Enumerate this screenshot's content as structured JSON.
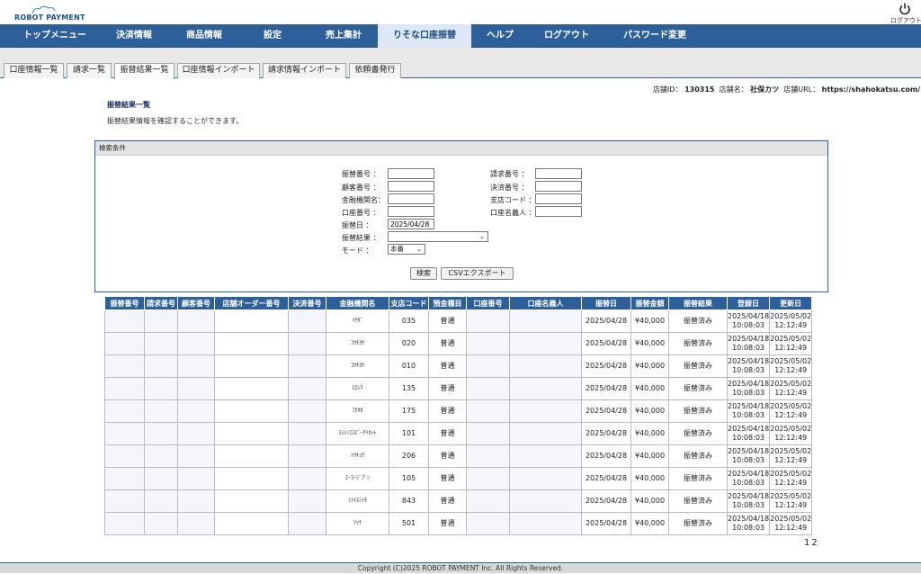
{
  "brand": {
    "logo_text": "ROBOT PAYMENT"
  },
  "header": {
    "logout_label": "ログアウト"
  },
  "nav": {
    "items": [
      {
        "label": "トップメニュー"
      },
      {
        "label": "決済情報"
      },
      {
        "label": "商品情報"
      },
      {
        "label": "設定"
      },
      {
        "label": "売上集計"
      },
      {
        "label": "りそな口座振替"
      },
      {
        "label": "ヘルプ"
      },
      {
        "label": "ログアウト"
      },
      {
        "label": "パスワード変更"
      }
    ],
    "active": "りそな口座振替"
  },
  "subtabs": [
    {
      "label": "口座情報一覧"
    },
    {
      "label": "請求一覧"
    },
    {
      "label": "振替結果一覧"
    },
    {
      "label": "口座情報インポート"
    },
    {
      "label": "請求情報インポート"
    },
    {
      "label": "依頼書発行"
    }
  ],
  "store": {
    "id_label": "店舗ID：",
    "id_value": "130315",
    "name_label": "店舗名：",
    "name_value": "社保カツ",
    "url_label": "店舗URL：",
    "url_value": "https://shahokatsu.com/"
  },
  "page": {
    "title": "振替結果一覧",
    "description": "振替結果情報を確認することができます。"
  },
  "search": {
    "header": "検索条件",
    "fields": {
      "transfer_no": {
        "label": "振替番号 ：",
        "value": ""
      },
      "customer_no": {
        "label": "顧客番号 ：",
        "value": ""
      },
      "bank_name": {
        "label": "金融機関名：",
        "value": ""
      },
      "account_no": {
        "label": "口座番号 ：",
        "value": ""
      },
      "transfer_date": {
        "label": "振替日 ：",
        "value": "2025/04/28"
      },
      "transfer_result": {
        "label": "振替結果 ：",
        "value": ""
      },
      "mode": {
        "label": "モード ：",
        "value": "本番"
      },
      "billing_no": {
        "label": "請求番号 ：",
        "value": ""
      },
      "payment_no": {
        "label": "決済番号 ：",
        "value": ""
      },
      "branch_code": {
        "label": "支店コード ：",
        "value": ""
      },
      "account_holder": {
        "label": "口座名義人 ：",
        "value": ""
      }
    },
    "search_button": "検索",
    "csv_button": "CSVエクスポート"
  },
  "table": {
    "columns": [
      "振替番号",
      "請求番号",
      "顧客番号",
      "店舗オーダー番号",
      "決済番号",
      "金融機関名",
      "支店コード",
      "預金種目",
      "口座番号",
      "口座名義人",
      "振替日",
      "振替金額",
      "振替結果",
      "登録日",
      "更新日"
    ],
    "rows": [
      {
        "bank": "ｲｹﾀﾞ",
        "branch": "035",
        "type": "普通",
        "date": "2025/04/28",
        "amount": "¥40,000",
        "result": "振替済み",
        "reg_d": "2025/04/18",
        "reg_t": "10:08:03",
        "upd_d": "2025/05/02",
        "upd_t": "12:12:49"
      },
      {
        "bank": "ｺｳﾁﾖｳ",
        "branch": "020",
        "type": "普通",
        "date": "2025/04/28",
        "amount": "¥40,000",
        "result": "振替済み",
        "reg_d": "2025/04/18",
        "reg_t": "10:08:03",
        "upd_d": "2025/05/02",
        "upd_t": "12:12:49"
      },
      {
        "bank": "ｺｳﾁﾖｳ",
        "branch": "010",
        "type": "普通",
        "date": "2025/04/28",
        "amount": "¥40,000",
        "result": "振替済み",
        "reg_d": "2025/04/18",
        "reg_t": "10:08:03",
        "upd_d": "2025/05/02",
        "upd_t": "12:12:49"
      },
      {
        "bank": "ﾋﾛｼﾏ",
        "branch": "135",
        "type": "普通",
        "date": "2025/04/28",
        "amount": "¥40,000",
        "result": "振替済み",
        "reg_d": "2025/04/18",
        "reg_t": "10:08:03",
        "upd_d": "2025/05/02",
        "upd_t": "12:12:49"
      },
      {
        "bank": "ﾌｸｵｶ",
        "branch": "175",
        "type": "普通",
        "date": "2025/04/28",
        "amount": "¥40,000",
        "result": "振替済み",
        "reg_d": "2025/04/18",
        "reg_t": "10:08:03",
        "upd_d": "2025/05/02",
        "upd_t": "12:12:49"
      },
      {
        "bank": "ｽﾐｼﾝｴｽﾋﾟｰｱｲﾈｯﾄ",
        "branch": "101",
        "type": "普通",
        "date": "2025/04/28",
        "amount": "¥40,000",
        "result": "振替済み",
        "reg_d": "2025/04/18",
        "reg_t": "10:08:03",
        "upd_d": "2025/05/02",
        "upd_t": "12:12:49"
      },
      {
        "bank": "ﾄｳｷｮｳ",
        "branch": "206",
        "type": "普通",
        "date": "2025/04/28",
        "amount": "¥40,000",
        "result": "振替済み",
        "reg_d": "2025/04/18",
        "reg_t": "10:08:03",
        "upd_d": "2025/05/02",
        "upd_t": "12:12:49"
      },
      {
        "bank": "ｴｰｺｰｼﾞﾌﾟﾝ",
        "branch": "105",
        "type": "普通",
        "date": "2025/04/28",
        "amount": "¥40,000",
        "result": "振替済み",
        "reg_d": "2025/04/18",
        "reg_t": "10:08:03",
        "upd_d": "2025/05/02",
        "upd_t": "12:12:49"
      },
      {
        "bank": "ﾐﾂｲｽﾐﾄﾓ",
        "branch": "843",
        "type": "普通",
        "date": "2025/04/28",
        "amount": "¥40,000",
        "result": "振替済み",
        "reg_d": "2025/04/18",
        "reg_t": "10:08:03",
        "upd_d": "2025/05/02",
        "upd_t": "12:12:49"
      },
      {
        "bank": "ﾘｿﾅ",
        "branch": "501",
        "type": "普通",
        "date": "2025/04/28",
        "amount": "¥40,000",
        "result": "振替済み",
        "reg_d": "2025/04/18",
        "reg_t": "10:08:03",
        "upd_d": "2025/05/02",
        "upd_t": "12:12:49"
      }
    ]
  },
  "pager": {
    "page1": "1",
    "page2": "2"
  },
  "footer": {
    "copyright": "Copyright (C)2025 ROBOT PAYMENT Inc. All Rights Reserved."
  },
  "colors": {
    "nav": "#2d5f9a",
    "nav_active_bg": "#dce8f6",
    "header_cell": "#2d5f9a"
  },
  "icons": {
    "logout": "power-icon",
    "logo": "cloud-logo-icon"
  }
}
